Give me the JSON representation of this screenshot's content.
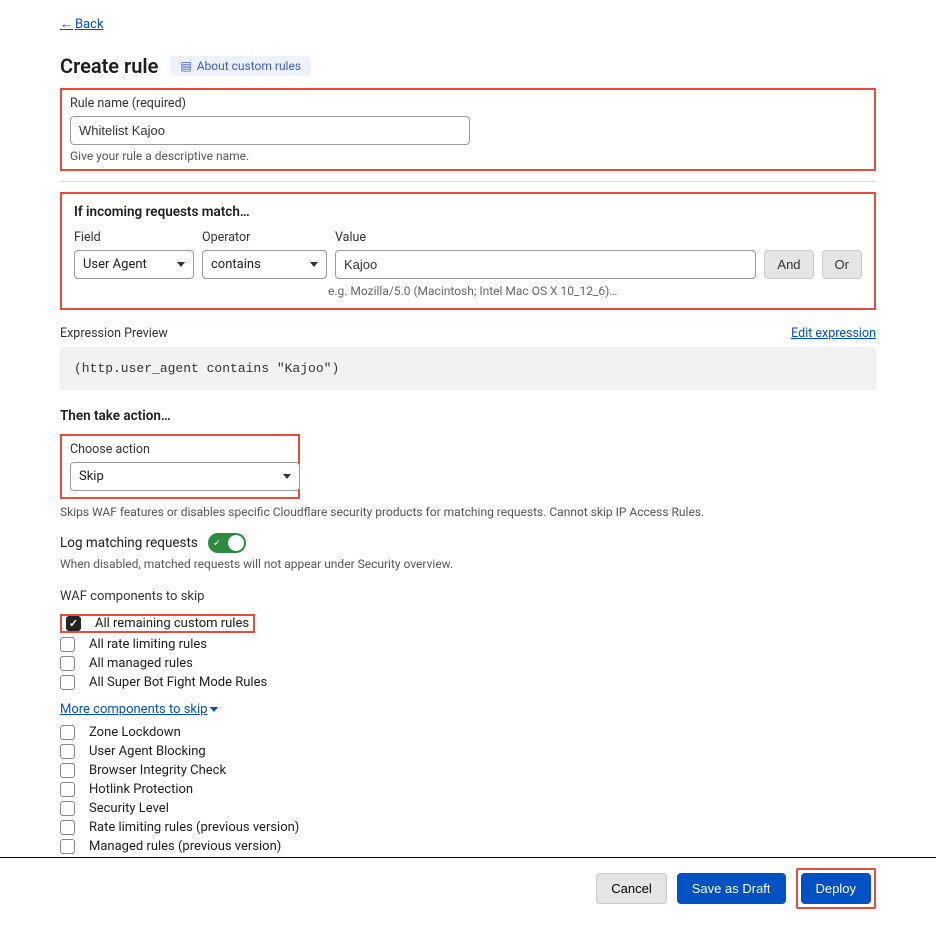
{
  "back": "Back",
  "title": "Create rule",
  "about": "About custom rules",
  "ruleName": {
    "label": "Rule name (required)",
    "value": "Whitelist Kajoo",
    "helper": "Give your rule a descriptive name."
  },
  "match": {
    "heading": "If incoming requests match…",
    "fieldLabel": "Field",
    "operatorLabel": "Operator",
    "valueLabel": "Value",
    "field": "User Agent",
    "operator": "contains",
    "value": "Kajoo",
    "example": "e.g. Mozilla/5.0 (Macintosh; Intel Mac OS X 10_12_6)…",
    "and": "And",
    "or": "Or"
  },
  "expression": {
    "label": "Expression Preview",
    "edit": "Edit expression",
    "code": "(http.user_agent contains \"Kajoo\")"
  },
  "action": {
    "heading": "Then take action…",
    "chooseLabel": "Choose action",
    "value": "Skip",
    "helper": "Skips WAF features or disables specific Cloudflare security products for matching requests. Cannot skip IP Access Rules."
  },
  "log": {
    "label": "Log matching requests",
    "helper": "When disabled, matched requests will not appear under Security overview."
  },
  "waf": {
    "heading": "WAF components to skip",
    "items": [
      {
        "label": "All remaining custom rules",
        "checked": true,
        "highlight": true
      },
      {
        "label": "All rate limiting rules",
        "checked": false
      },
      {
        "label": "All managed rules",
        "checked": false
      },
      {
        "label": "All Super Bot Fight Mode Rules",
        "checked": false
      }
    ]
  },
  "more": {
    "link": "More components to skip",
    "items": [
      {
        "label": "Zone Lockdown"
      },
      {
        "label": "User Agent Blocking"
      },
      {
        "label": "Browser Integrity Check"
      },
      {
        "label": "Hotlink Protection"
      },
      {
        "label": "Security Level"
      },
      {
        "label": "Rate limiting rules (previous version)"
      },
      {
        "label": "Managed rules (previous version)"
      }
    ]
  },
  "buttons": {
    "cancel": "Cancel",
    "draft": "Save as Draft",
    "deploy": "Deploy"
  }
}
